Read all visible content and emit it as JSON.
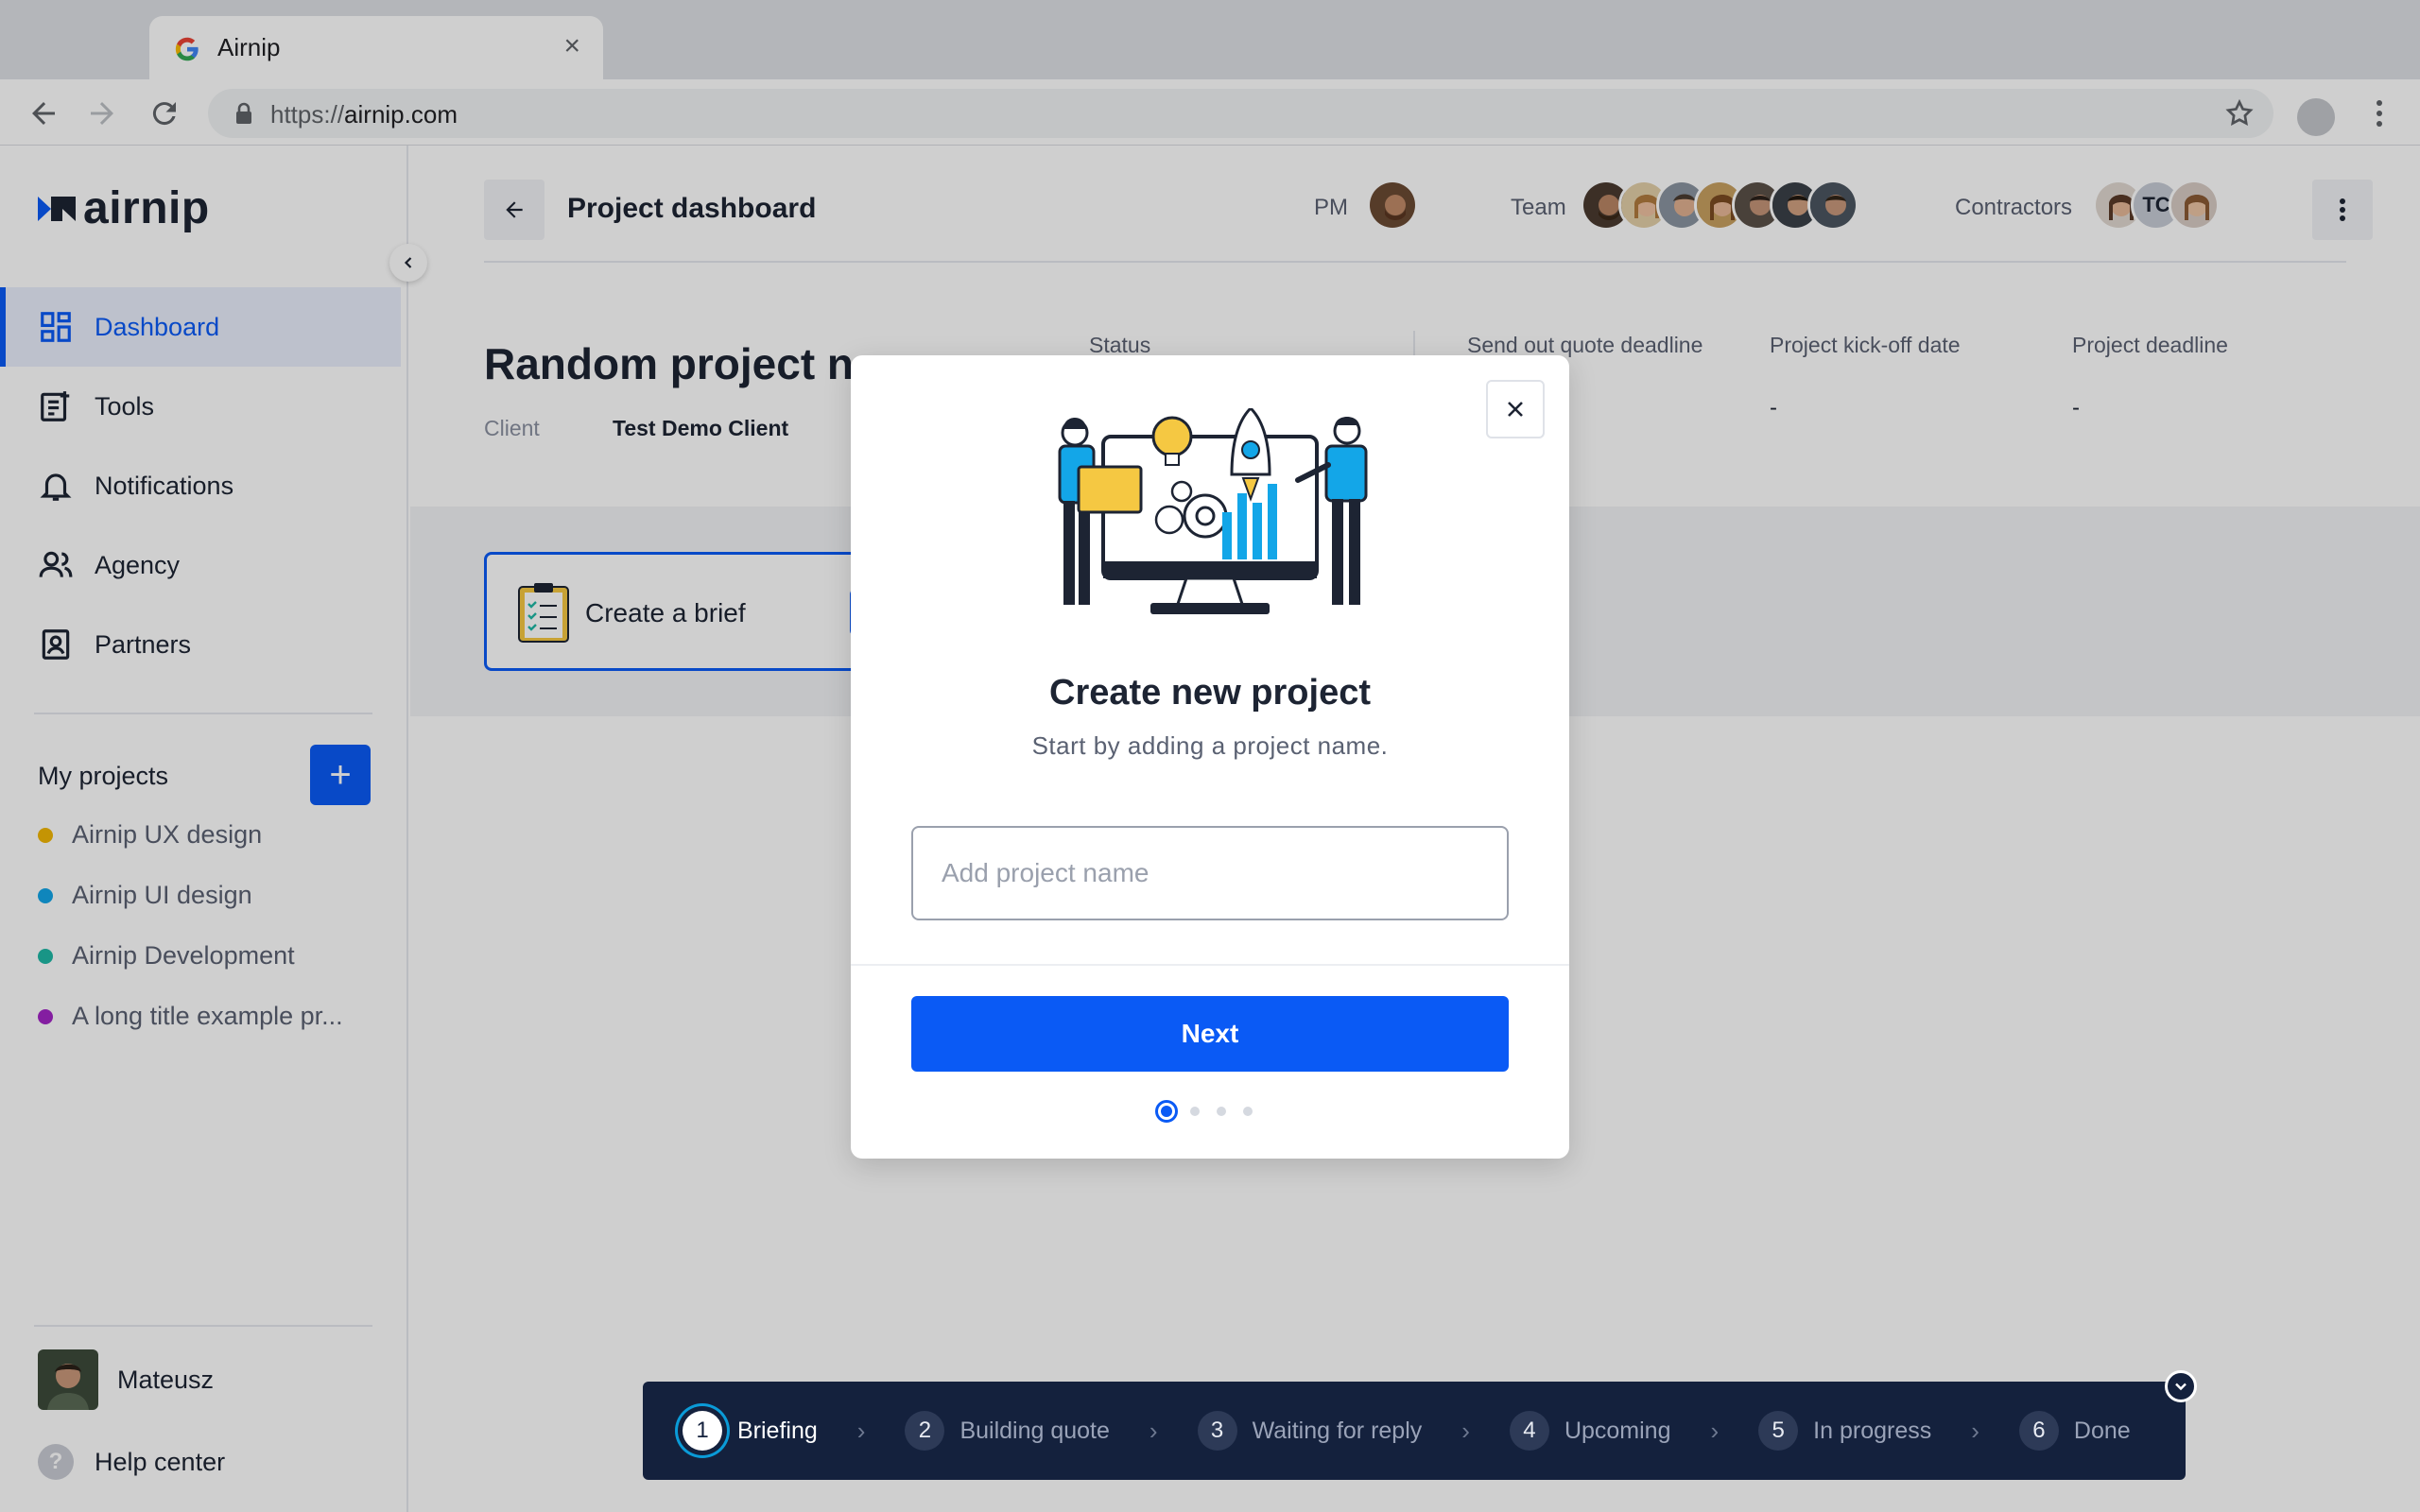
{
  "browser": {
    "tab_title": "Airnip",
    "url_scheme": "https://",
    "url_host": "airnip.com"
  },
  "sidebar": {
    "logo": "airnip",
    "nav": [
      {
        "label": "Dashboard",
        "icon": "dashboard-grid-icon",
        "active": true
      },
      {
        "label": "Tools",
        "icon": "tools-list-icon"
      },
      {
        "label": "Notifications",
        "icon": "bell-icon"
      },
      {
        "label": "Agency",
        "icon": "people-icon"
      },
      {
        "label": "Partners",
        "icon": "contact-card-icon"
      }
    ],
    "my_projects_title": "My projects",
    "projects": [
      {
        "label": "Airnip UX design",
        "color": "#f2b705"
      },
      {
        "label": "Airnip UI design",
        "color": "#13a6e8"
      },
      {
        "label": "Airnip Development",
        "color": "#1fb8a6"
      },
      {
        "label": "A long title example pr...",
        "color": "#a325c7"
      }
    ],
    "user_name": "Mateusz",
    "help_label": "Help center"
  },
  "header": {
    "title": "Project dashboard",
    "pm_label": "PM",
    "team_label": "Team",
    "contractors_label": "Contractors",
    "contractor_initials": "TC"
  },
  "project": {
    "name": "Random project na",
    "client_label": "Client",
    "client_value": "Test Demo Client",
    "status_label": "Status",
    "quote_deadline_label": "Send out quote deadline",
    "quote_deadline_value": "-",
    "kickoff_label": "Project kick-off date",
    "kickoff_value": "-",
    "deadline_label": "Project deadline",
    "deadline_value": "-",
    "brief_card_label": "Create a brief"
  },
  "modal": {
    "title": "Create new project",
    "subtitle": "Start by adding a project name.",
    "input_placeholder": "Add project name",
    "input_value": "",
    "next_label": "Next",
    "current_step": 1,
    "total_steps": 4
  },
  "stepper": {
    "steps": [
      {
        "num": "1",
        "label": "Briefing",
        "active": true
      },
      {
        "num": "2",
        "label": "Building quote"
      },
      {
        "num": "3",
        "label": "Waiting for reply"
      },
      {
        "num": "4",
        "label": "Upcoming"
      },
      {
        "num": "5",
        "label": "In progress"
      },
      {
        "num": "6",
        "label": "Done"
      }
    ]
  },
  "colors": {
    "accent": "#0a5af5",
    "stepper_bg": "#14213d",
    "active_nav_bg": "#e9eefc"
  }
}
